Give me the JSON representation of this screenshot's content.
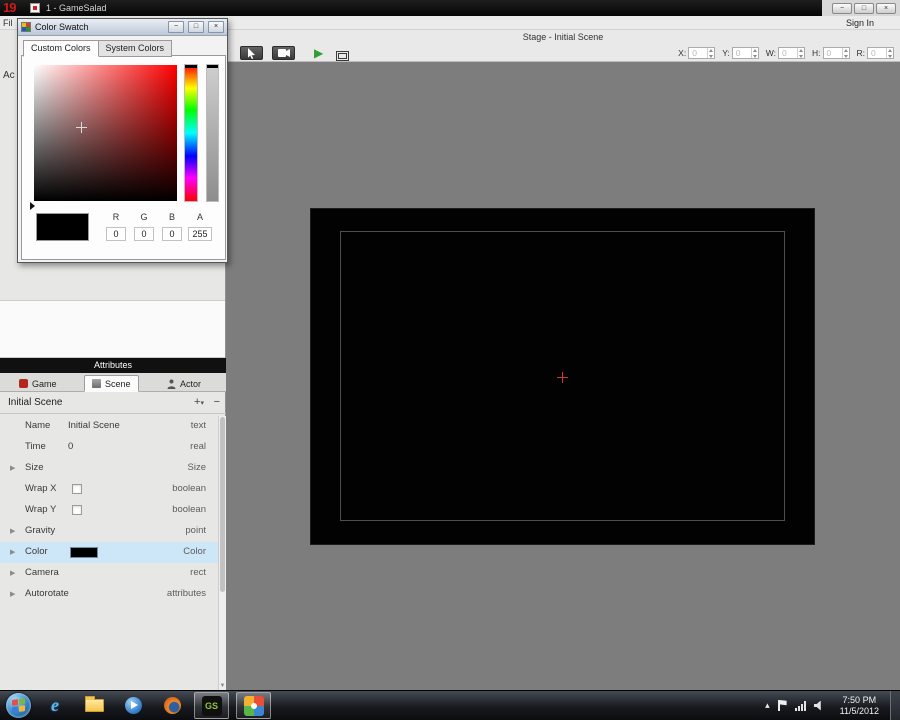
{
  "icons": {
    "minimize": "−",
    "maximize": "□",
    "close": "×",
    "play": "▶",
    "expander": "▶",
    "caret": "▾",
    "add": "+",
    "remove": "−",
    "scroll_down": "▼",
    "chevron_up": "▴"
  },
  "window": {
    "badge": "19",
    "title": "1 - GameSalad"
  },
  "menubar": {
    "file_fragment": "Fil",
    "sign_in": "Sign In"
  },
  "left_panel": {
    "actors_fragment": "Ac"
  },
  "stage": {
    "header": "Stage - Initial Scene",
    "fields": [
      {
        "label": "X:",
        "value": "0"
      },
      {
        "label": "Y:",
        "value": "0"
      },
      {
        "label": "W:",
        "value": "0"
      },
      {
        "label": "H:",
        "value": "0"
      },
      {
        "label": "R:",
        "value": "0"
      }
    ]
  },
  "color_dialog": {
    "title": "Color Swatch",
    "tabs": [
      {
        "label": "Custom Colors"
      },
      {
        "label": "System Colors"
      }
    ],
    "active_tab": "Custom Colors",
    "channels": [
      {
        "label": "R",
        "value": "0"
      },
      {
        "label": "G",
        "value": "0"
      },
      {
        "label": "B",
        "value": "0"
      },
      {
        "label": "A",
        "value": "255"
      }
    ],
    "preview_color": "#000000"
  },
  "attributes": {
    "header": "Attributes",
    "tabs": [
      {
        "label": "Game"
      },
      {
        "label": "Scene"
      },
      {
        "label": "Actor"
      }
    ],
    "active_tab": "Scene",
    "title_row": {
      "title": "Initial Scene"
    },
    "rows": [
      {
        "name": "Name",
        "value": "Initial Scene",
        "type": "text"
      },
      {
        "name": "Time",
        "value": "0",
        "type": "real"
      },
      {
        "name": "Size",
        "value": "",
        "type": "Size"
      },
      {
        "name": "Wrap X",
        "value": "",
        "type": "boolean"
      },
      {
        "name": "Wrap Y",
        "value": "",
        "type": "boolean"
      },
      {
        "name": "Gravity",
        "value": "",
        "type": "point"
      },
      {
        "name": "Color",
        "value": "",
        "type": "Color",
        "swatch": "#000000",
        "highlighted": true
      },
      {
        "name": "Camera",
        "value": "",
        "type": "rect"
      },
      {
        "name": "Autorotate",
        "value": "",
        "type": "attributes"
      }
    ]
  },
  "taskbar": {
    "gs_label": "GS",
    "clock": {
      "time": "7:50 PM",
      "date": "11/5/2012"
    }
  },
  "colors": {
    "selection_highlight": "#cde6f8",
    "stage_background": "#7d7d7d"
  }
}
